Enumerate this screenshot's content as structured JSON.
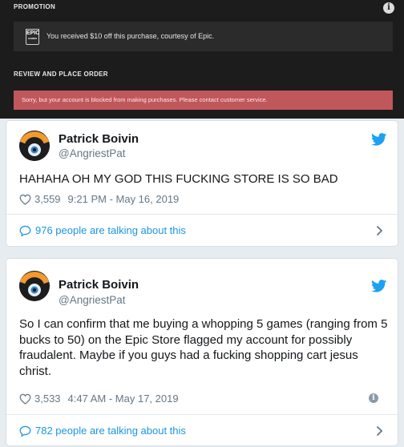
{
  "epic": {
    "promotion_title": "PROMOTION",
    "logo_text": "EPIC",
    "logo_subtext": "GAMES",
    "promo_text": "You received $10 off this purchase, courtesy of Epic.",
    "review_title": "REVIEW AND PLACE ORDER",
    "error_text": "Sorry, but your account is blocked from making purchases. Please contact customer service.",
    "colors": {
      "background": "#1c1c1c",
      "error": "#c0575b"
    }
  },
  "tweets": [
    {
      "name": "Patrick Boivin",
      "handle": "@AngriestPat",
      "text": "HAHAHA OH MY GOD THIS FUCKING STORE IS SO BAD",
      "likes": "3,559",
      "timestamp": "9:21 PM - May 16, 2019",
      "talking": "976 people are talking about this"
    },
    {
      "name": "Patrick Boivin",
      "handle": "@AngriestPat",
      "text": "So I can confirm that me buying a whopping 5 games (ranging from 5 bucks to 50) on the Epic Store flagged my account for possibly fraudalent. Maybe if you guys had a fucking shopping cart jesus christ.",
      "likes": "3,533",
      "timestamp": "4:47 AM - May 17, 2019",
      "talking": "782 people are talking about this"
    }
  ],
  "icons": {
    "avatar": "pat-stores-logo-avatar",
    "bird": "twitter-bird-icon",
    "heart": "heart-icon",
    "bubble": "speech-bubble-icon",
    "chevron": "chevron-right-icon",
    "info": "info-icon"
  },
  "colors": {
    "link": "#1b95e0",
    "muted": "#657786",
    "text": "#14171a"
  }
}
